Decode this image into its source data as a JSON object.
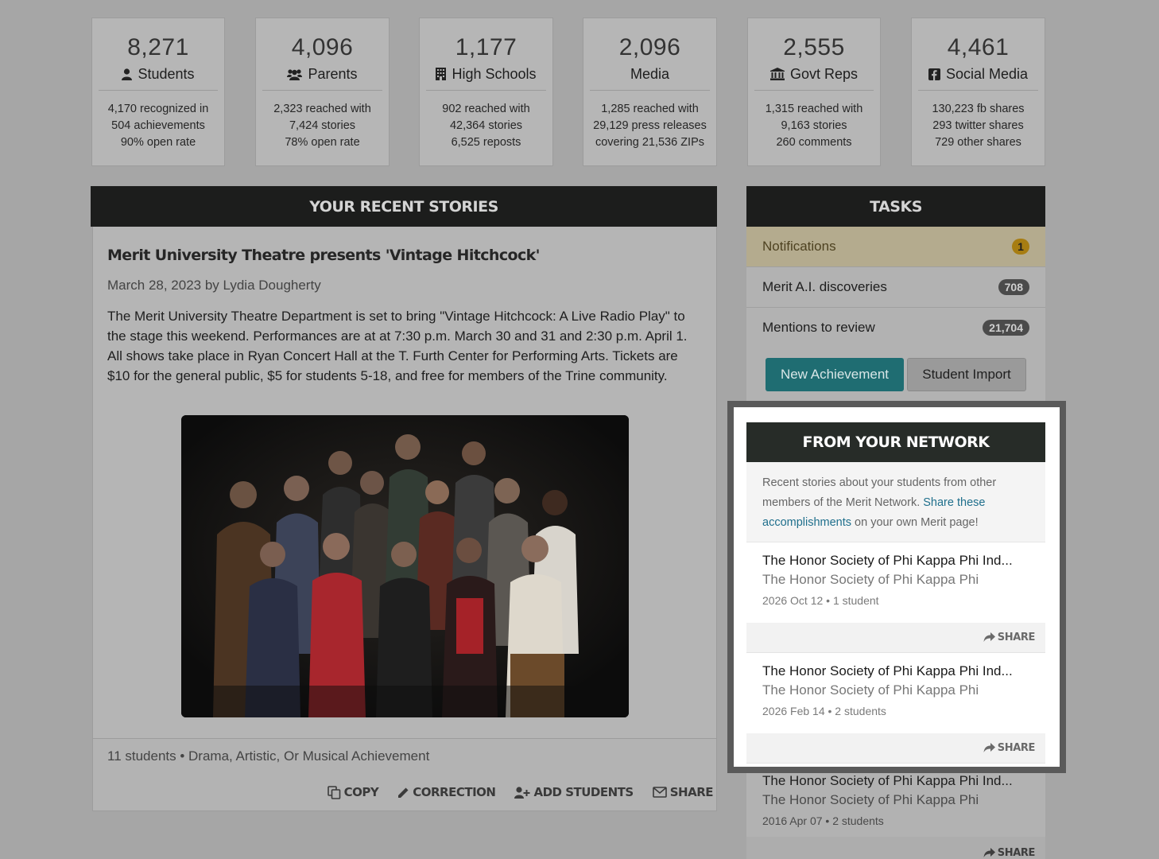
{
  "stats": [
    {
      "number": "8,271",
      "label": "Students",
      "icon": "user-icon",
      "lines": [
        "4,170 recognized in",
        "504 achievements",
        "90% open rate"
      ]
    },
    {
      "number": "4,096",
      "label": "Parents",
      "icon": "users-icon",
      "lines": [
        "2,323 reached with",
        "7,424 stories",
        "78% open rate"
      ]
    },
    {
      "number": "1,177",
      "label": "High Schools",
      "icon": "building-icon",
      "lines": [
        "902 reached with",
        "42,364 stories",
        "6,525 reposts"
      ]
    },
    {
      "number": "2,096",
      "label": "Media",
      "icon": "",
      "lines": [
        "1,285 reached with",
        "29,129 press releases",
        "covering 21,536 ZIPs"
      ]
    },
    {
      "number": "2,555",
      "label": "Govt Reps",
      "icon": "institution-icon",
      "lines": [
        "1,315 reached with",
        "9,163 stories",
        "260 comments"
      ]
    },
    {
      "number": "4,461",
      "label": "Social Media",
      "icon": "facebook-icon",
      "lines": [
        "130,223 fb shares",
        "293 twitter shares",
        "729 other shares"
      ]
    }
  ],
  "recent": {
    "header": "YOUR RECENT STORIES",
    "title": "Merit University Theatre presents 'Vintage Hitchcock'",
    "meta": "March 28, 2023 by Lydia Dougherty",
    "body": "The Merit University Theatre Department is set to bring \"Vintage Hitchcock: A Live Radio Play\" to the stage this weekend. Performances are at at 7:30 p.m. March 30 and 31 and 2:30 p.m. April 1. All shows take place in Ryan Concert Hall at the T. Furth Center for Performing Arts. Tickets are $10 for the general public, $5 for students 5-18, and free for members of the Trine community.",
    "tags": "11 students • Drama, Artistic, Or Musical Achievement",
    "actions": {
      "copy": "COPY",
      "correction": "CORRECTION",
      "add_students": "ADD STUDENTS",
      "share": "SHARE"
    }
  },
  "tasks": {
    "header": "TASKS",
    "rows": [
      {
        "label": "Notifications",
        "count": "1"
      },
      {
        "label": "Merit A.I. discoveries",
        "count": "708"
      },
      {
        "label": "Mentions to review",
        "count": "21,704"
      }
    ],
    "new_achievement": "New Achievement",
    "student_import": "Student Import"
  },
  "network": {
    "header": "FROM YOUR NETWORK",
    "intro_prefix": "Recent stories about your students from other members of the Merit Network. ",
    "intro_link": "Share these accomplishments",
    "intro_suffix": " on your own Merit page!",
    "share_label": "SHARE",
    "items": [
      {
        "title": "The Honor Society of Phi Kappa Phi Ind...",
        "org": "The Honor Society of Phi Kappa Phi",
        "date": "2026 Oct 12 • 1 student"
      },
      {
        "title": "The Honor Society of Phi Kappa Phi Ind...",
        "org": "The Honor Society of Phi Kappa Phi",
        "date": "2026 Feb 14 • 2 students"
      },
      {
        "title": "The Honor Society of Phi Kappa Phi Ind...",
        "org": "The Honor Society of Phi Kappa Phi",
        "date": "2016 Apr 07 • 2 students"
      }
    ]
  },
  "colors": {
    "teal": "#1f6d72",
    "gold_badge": "#a77d12",
    "dark_header": "#1c1d1c",
    "link": "#1f6f8c"
  }
}
